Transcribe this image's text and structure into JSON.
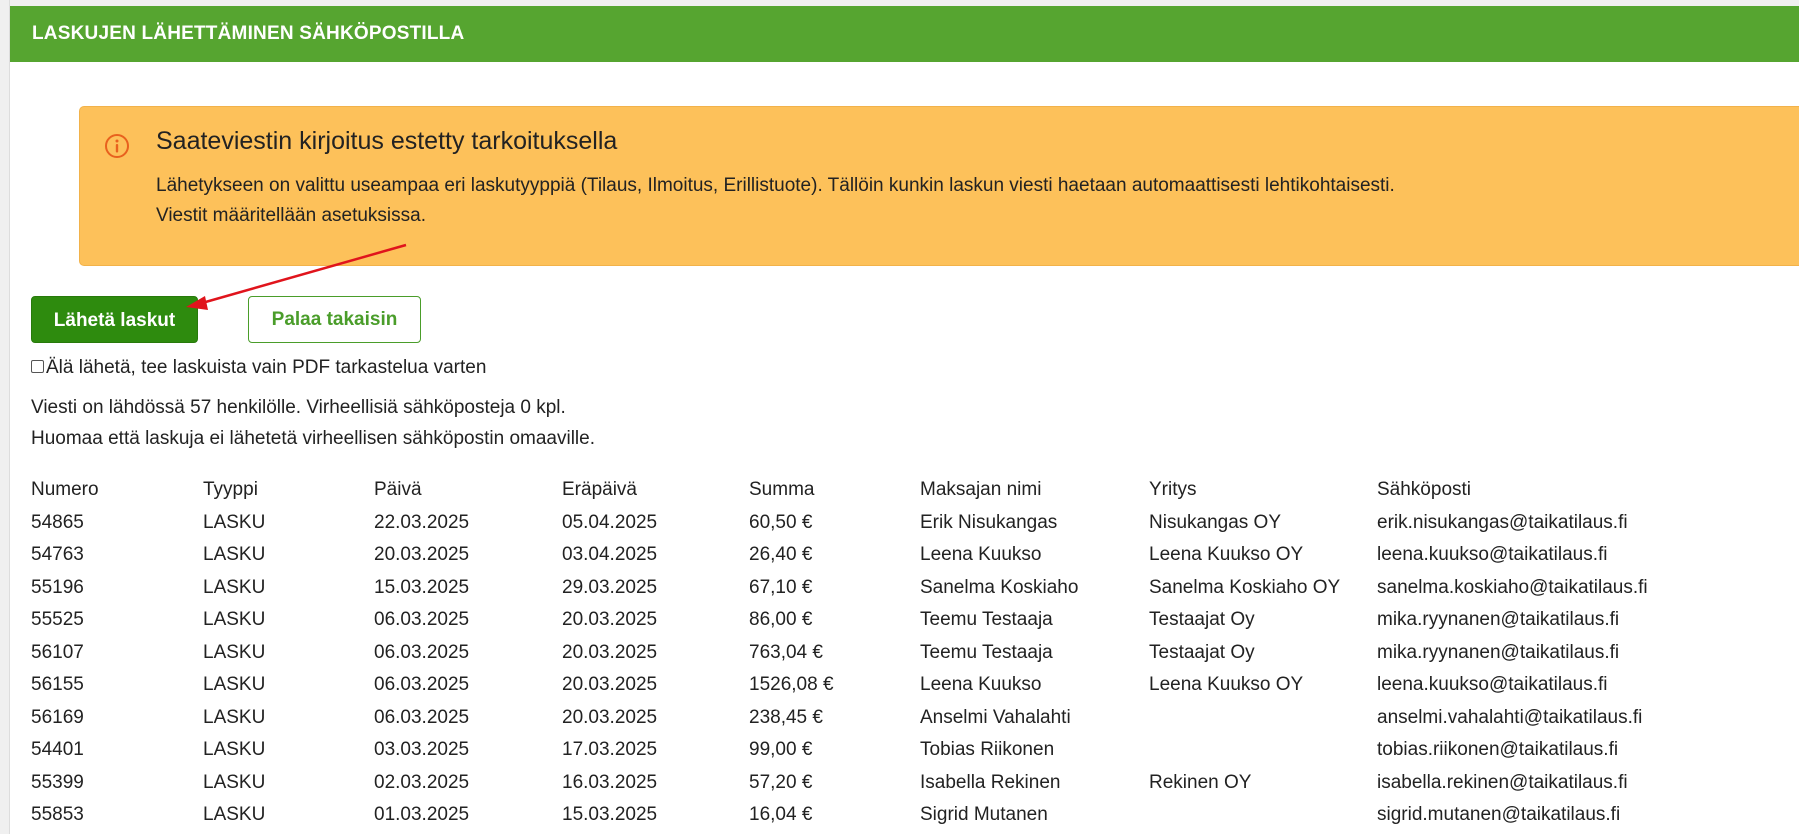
{
  "header": {
    "title": "LASKUJEN LÄHETTÄMINEN SÄHKÖPOSTILLA"
  },
  "colors": {
    "header": "#56a530",
    "alert": "#fdc15a",
    "primary_button": "#2e8b0e",
    "arrow": "#e0141c"
  },
  "alert": {
    "icon": "info-circle-icon",
    "title": "Saateviestin kirjoitus estetty tarkoituksella",
    "line1": "Lähetykseen on valittu useampaa eri laskutyyppiä (Tilaus, Ilmoitus, Erillistuote). Tällöin kunkin laskun viesti haetaan automaattisesti lehtikohtaisesti.",
    "line2": "Viestit määritellään asetuksissa."
  },
  "buttons": {
    "send_label": "Lähetä laskut",
    "back_label": "Palaa takaisin"
  },
  "pdf_option": {
    "checked": false,
    "label": "Älä lähetä, tee laskuista vain PDF tarkastelua varten"
  },
  "info": {
    "line1": "Viesti on lähdössä 57 henkilölle. Virheellisiä sähköposteja 0 kpl.",
    "line2": "Huomaa että laskuja ei lähetetä virheellisen sähköpostin omaaville."
  },
  "table": {
    "headers": [
      "Numero",
      "Tyyppi",
      "Päivä",
      "Eräpäivä",
      "Summa",
      "Maksajan nimi",
      "Yritys",
      "Sähköposti"
    ],
    "rows": [
      [
        "54865",
        "LASKU",
        "22.03.2025",
        "05.04.2025",
        "60,50 €",
        "Erik Nisukangas",
        "Nisukangas OY",
        "erik.nisukangas@taikatilaus.fi"
      ],
      [
        "54763",
        "LASKU",
        "20.03.2025",
        "03.04.2025",
        "26,40 €",
        "Leena Kuukso",
        "Leena Kuukso OY",
        "leena.kuukso@taikatilaus.fi"
      ],
      [
        "55196",
        "LASKU",
        "15.03.2025",
        "29.03.2025",
        "67,10 €",
        "Sanelma Koskiaho",
        "Sanelma Koskiaho OY",
        "sanelma.koskiaho@taikatilaus.fi"
      ],
      [
        "55525",
        "LASKU",
        "06.03.2025",
        "20.03.2025",
        "86,00 €",
        "Teemu Testaaja",
        "Testaajat Oy",
        "mika.ryynanen@taikatilaus.fi"
      ],
      [
        "56107",
        "LASKU",
        "06.03.2025",
        "20.03.2025",
        "763,04 €",
        "Teemu Testaaja",
        "Testaajat Oy",
        "mika.ryynanen@taikatilaus.fi"
      ],
      [
        "56155",
        "LASKU",
        "06.03.2025",
        "20.03.2025",
        "1526,08 €",
        "Leena Kuukso",
        "Leena Kuukso OY",
        "leena.kuukso@taikatilaus.fi"
      ],
      [
        "56169",
        "LASKU",
        "06.03.2025",
        "20.03.2025",
        "238,45 €",
        "Anselmi Vahalahti",
        "",
        "anselmi.vahalahti@taikatilaus.fi"
      ],
      [
        "54401",
        "LASKU",
        "03.03.2025",
        "17.03.2025",
        "99,00 €",
        "Tobias Riikonen",
        "",
        "tobias.riikonen@taikatilaus.fi"
      ],
      [
        "55399",
        "LASKU",
        "02.03.2025",
        "16.03.2025",
        "57,20 €",
        "Isabella Rekinen",
        "Rekinen OY",
        "isabella.rekinen@taikatilaus.fi"
      ],
      [
        "55853",
        "LASKU",
        "01.03.2025",
        "15.03.2025",
        "16,04 €",
        "Sigrid Mutanen",
        "",
        "sigrid.mutanen@taikatilaus.fi"
      ]
    ]
  }
}
